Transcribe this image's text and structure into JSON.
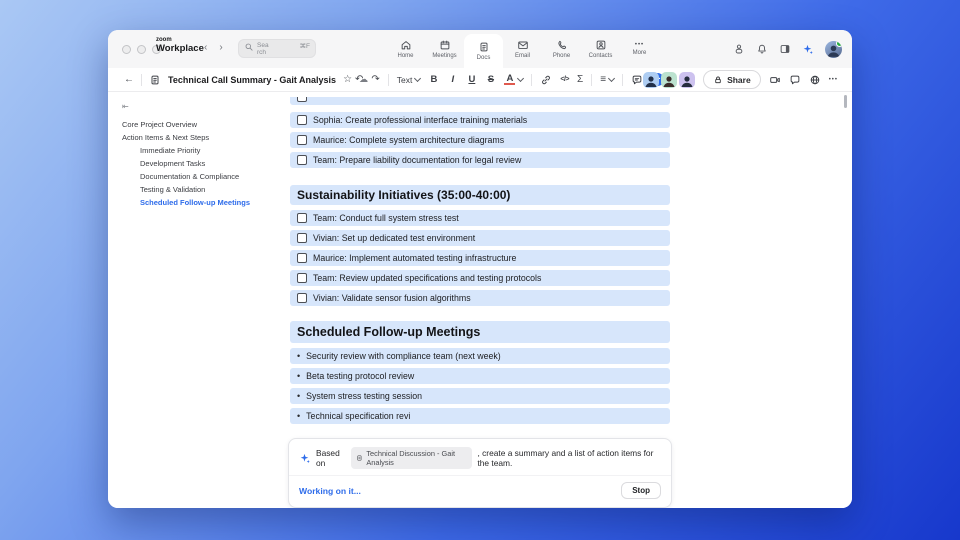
{
  "topbar": {
    "logo_top": "zoom",
    "logo_bottom": "Workplace",
    "search": {
      "placeholder_line1": "Sea",
      "placeholder_line2": "rch",
      "shortcut": "⌘F"
    },
    "nav": [
      {
        "label": "Home",
        "active": false
      },
      {
        "label": "Meetings",
        "active": false
      },
      {
        "label": "Docs",
        "active": true
      },
      {
        "label": "Email",
        "active": false
      },
      {
        "label": "Phone",
        "active": false
      },
      {
        "label": "Contacts",
        "active": false
      },
      {
        "label": "More",
        "active": false
      }
    ]
  },
  "doc_toolbar": {
    "title": "Technical Call Summary - Gait Analysis",
    "text_style_label": "Text",
    "share_label": "Share"
  },
  "outline": {
    "items": [
      {
        "label": "Core Project Overview",
        "level": 0,
        "active": false
      },
      {
        "label": "Action Items & Next Steps",
        "level": 0,
        "active": false
      },
      {
        "label": "Immediate Priority",
        "level": 1,
        "active": false
      },
      {
        "label": "Development Tasks",
        "level": 1,
        "active": false
      },
      {
        "label": "Documentation & Compliance",
        "level": 1,
        "active": false
      },
      {
        "label": "Testing & Validation",
        "level": 1,
        "active": false
      },
      {
        "label": "Scheduled Follow-up Meetings",
        "level": 1,
        "active": true
      }
    ]
  },
  "document": {
    "clipped_item": "",
    "action_items_top": [
      "Sophia: Create professional interface training materials",
      "Maurice: Complete system architecture diagrams",
      "Team: Prepare liability documentation for legal review"
    ],
    "heading_sustainability": "Sustainability Initiatives (35:00-40:00)",
    "sustainability_items": [
      "Team: Conduct full system stress test",
      "Vivian: Set up dedicated test environment",
      "Maurice: Implement automated testing infrastructure",
      "Team: Review updated specifications and testing protocols",
      "Vivian: Validate sensor fusion algorithms"
    ],
    "heading_meetings": "Scheduled Follow-up Meetings",
    "meeting_items": [
      "Security review with compliance team (next week)",
      "Beta testing protocol review",
      "System stress testing session",
      "Technical specification revi"
    ]
  },
  "ai_panel": {
    "based_on": "Based on",
    "chip_label": "Technical Discussion - Gait Analysis",
    "prompt_suffix": ", create a summary and a list of action items for the team.",
    "status": "Working on it...",
    "stop_label": "Stop"
  },
  "glyphs": {
    "back": "←",
    "nav_prev": "‹",
    "nav_next": "›",
    "star": "☆",
    "cloud": "☁",
    "undo": "↶",
    "redo": "↷",
    "bold": "B",
    "italic": "I",
    "underline": "U",
    "strikethrough": "S",
    "text_color": "A",
    "code": "</>",
    "formula": "Σ",
    "align": "≡",
    "collapse_caret": "^",
    "more_dots": "•••",
    "outline_collapse": "⇤",
    "bullet": "•",
    "plus": "+"
  },
  "colors": {
    "accent_blue": "#2e6cea",
    "row_highlight": "#d7e6fb",
    "topbar_bg": "#f6f6f7",
    "background_gradient_start": "#aac8f4",
    "background_gradient_end": "#1738cc"
  }
}
